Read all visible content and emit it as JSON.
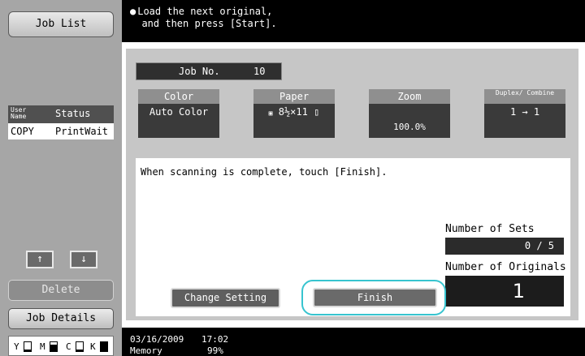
{
  "sidebar": {
    "job_list_label": "Job List",
    "table": {
      "col_user_name": "User Name",
      "col_status": "Status",
      "rows": [
        {
          "user": "COPY",
          "status": "PrintWait"
        }
      ]
    },
    "up_arrow": "↑",
    "down_arrow": "↓",
    "delete_label": "Delete",
    "job_details_label": "Job Details",
    "toner": [
      {
        "label": "Y",
        "level": 0.2
      },
      {
        "label": "M",
        "level": 0.75
      },
      {
        "label": "C",
        "level": 0.2
      },
      {
        "label": "K",
        "level": 1.0
      }
    ]
  },
  "header": {
    "message_line1": "Load the next original,",
    "message_line2": "and then press [Start]."
  },
  "main": {
    "job_no_label": "Job No.",
    "job_no_value": "10",
    "settings": [
      {
        "label": "Color",
        "value": "Auto Color"
      },
      {
        "label": "Paper",
        "value": "8½×11"
      },
      {
        "label": "Zoom",
        "value": "100.0%"
      },
      {
        "label": "Duplex/ Combine",
        "value": "1 → 1"
      }
    ],
    "scan_message": "When scanning is complete, touch [Finish].",
    "number_of_sets_label": "Number of Sets",
    "number_of_sets_value": "0 / 5",
    "number_of_originals_label": "Number of Originals",
    "number_of_originals_value": "1",
    "change_setting_label": "Change Setting",
    "finish_label": "Finish"
  },
  "status_bar": {
    "date": "03/16/2009",
    "time": "17:02",
    "memory_label": "Memory",
    "memory_value": "99%"
  },
  "colors": {
    "highlight_ring": "#37c4cf",
    "sidebar_bg": "#a6a6a6",
    "panel_bg": "#c6c6c6"
  }
}
